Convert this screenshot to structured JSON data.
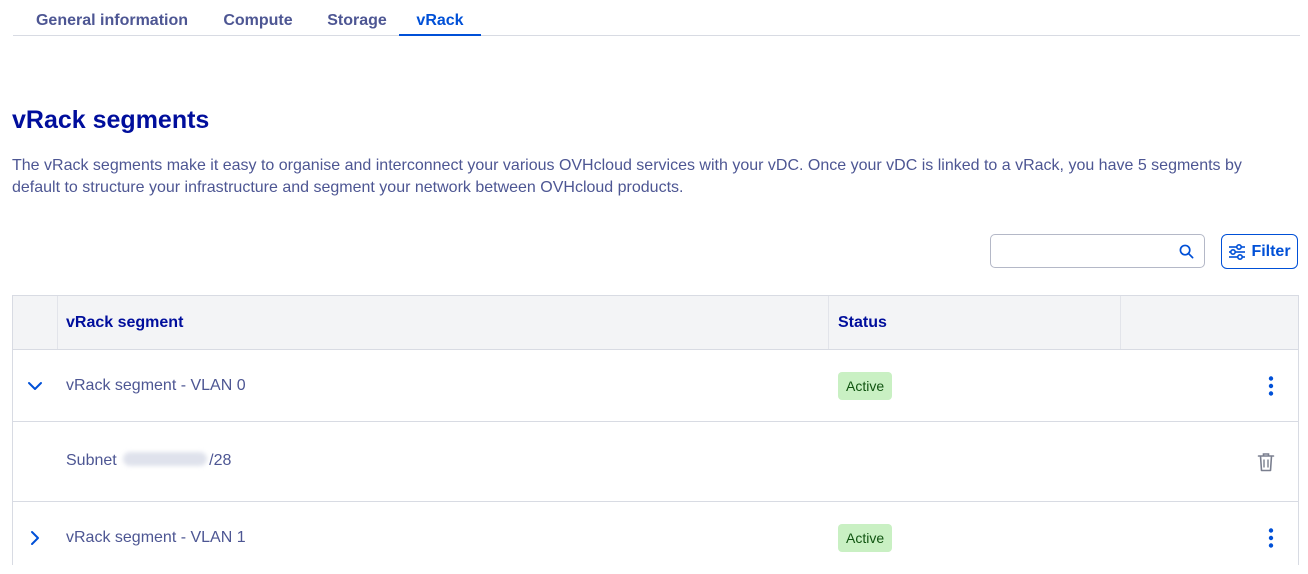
{
  "tabs": [
    {
      "label": "General information",
      "active": false
    },
    {
      "label": "Compute",
      "active": false
    },
    {
      "label": "Storage",
      "active": false
    },
    {
      "label": "vRack",
      "active": true
    }
  ],
  "page": {
    "title": "vRack segments",
    "description": "The vRack segments make it easy to organise and interconnect your various OVHcloud services with your vDC. Once your vDC is linked to a vRack, you have 5 segments by default to structure your infrastructure and segment your network between OVHcloud products."
  },
  "toolbar": {
    "search_value": "",
    "search_placeholder": "",
    "filter_label": "Filter"
  },
  "table": {
    "columns": [
      "vRack segment",
      "Status"
    ],
    "rows": [
      {
        "name": "vRack segment - VLAN 0",
        "status": "Active",
        "expanded": true
      },
      {
        "subnet_label": "Subnet",
        "subnet_suffix": "/28"
      },
      {
        "name": "vRack segment - VLAN 1",
        "status": "Active",
        "expanded": false
      }
    ]
  },
  "colors": {
    "accent": "#0050d7",
    "title": "#000e9c",
    "text": "#4d5693",
    "badge_bg": "#c9f0c3",
    "badge_text": "#105410"
  },
  "icons": {
    "search": "search-icon",
    "filter": "sliders-icon",
    "expand_open": "chevron-down-icon",
    "expand_closed": "chevron-right-icon",
    "row_menu": "kebab-menu-icon",
    "delete": "trash-icon"
  }
}
